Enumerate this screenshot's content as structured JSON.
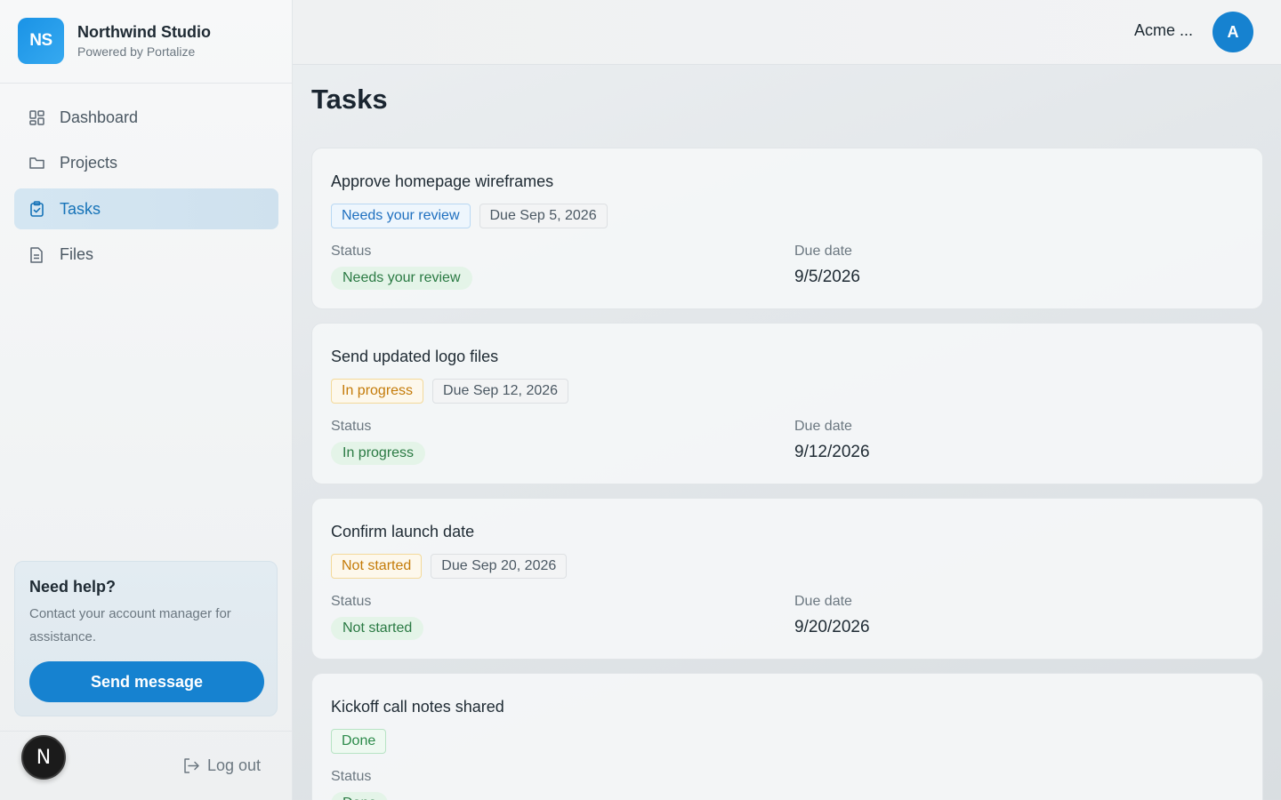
{
  "brand": {
    "initials": "NS",
    "name": "Northwind Studio",
    "subtitle": "Powered by Portalize"
  },
  "nav": {
    "items": [
      {
        "label": "Dashboard",
        "icon": "grid-icon",
        "active": false
      },
      {
        "label": "Projects",
        "icon": "folder-icon",
        "active": false
      },
      {
        "label": "Tasks",
        "icon": "clipboard-check-icon",
        "active": true
      },
      {
        "label": "Files",
        "icon": "file-icon",
        "active": false
      }
    ]
  },
  "help": {
    "title": "Need help?",
    "text": "Contact your account manager for assistance.",
    "button": "Send message"
  },
  "footer": {
    "badge": "N",
    "logout": "Log out"
  },
  "header": {
    "account": "Acme ...",
    "avatar": "A"
  },
  "page": {
    "title": "Tasks"
  },
  "labels": {
    "status": "Status",
    "due_date": "Due date"
  },
  "tasks": [
    {
      "title": "Approve homepage wireframes",
      "status": "Needs your review",
      "status_tone": "blue",
      "due_badge": "Due Sep 5, 2026",
      "due_date": "9/5/2026"
    },
    {
      "title": "Send updated logo files",
      "status": "In progress",
      "status_tone": "orange",
      "due_badge": "Due Sep 12, 2026",
      "due_date": "9/12/2026"
    },
    {
      "title": "Confirm launch date",
      "status": "Not started",
      "status_tone": "orange",
      "due_badge": "Due Sep 20, 2026",
      "due_date": "9/20/2026"
    },
    {
      "title": "Kickoff call notes shared",
      "status": "Done",
      "status_tone": "green",
      "due_badge": "",
      "due_date": ""
    }
  ],
  "colors": {
    "accent": "#1682d0",
    "active_nav_bg": "#d4e6f2",
    "status_pill_bg": "#e4f4e8"
  }
}
